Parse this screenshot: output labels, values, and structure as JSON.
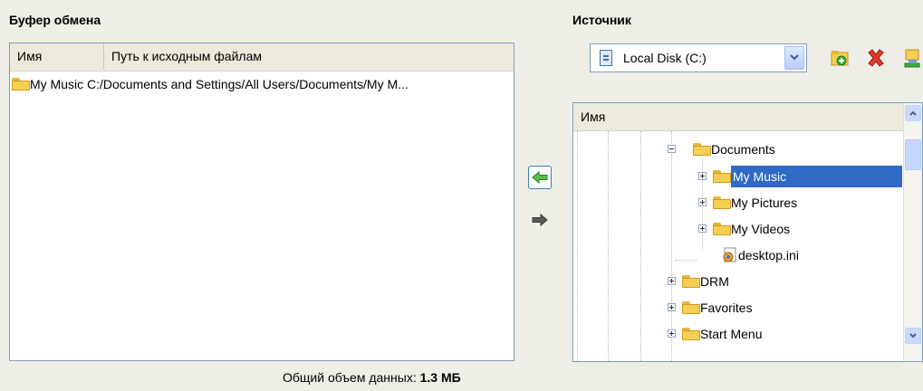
{
  "clipboard": {
    "title": "Буфер обмена",
    "columns": [
      "Имя",
      "Путь к исходным файлам"
    ],
    "rows": [
      {
        "name": "My Music",
        "path": "C:/Documents and Settings/All Users/Documents/My M..."
      }
    ],
    "total_label": "Общий объем данных:",
    "total_value": "1.3 МБ"
  },
  "source": {
    "title": "Источник",
    "drive": "Local Disk (C:)",
    "tree_header": "Имя",
    "tree": [
      {
        "label": "Documents",
        "expander": "minus",
        "selected": false
      },
      {
        "label": "My Music",
        "expander": "plus",
        "selected": true
      },
      {
        "label": "My Pictures",
        "expander": "plus",
        "selected": false
      },
      {
        "label": "My Videos",
        "expander": "plus",
        "selected": false
      },
      {
        "label": "desktop.ini",
        "expander": "none",
        "selected": false
      },
      {
        "label": "DRM",
        "expander": "plus",
        "selected": false
      },
      {
        "label": "Favorites",
        "expander": "plus",
        "selected": false
      },
      {
        "label": "Start Menu",
        "expander": "plus",
        "selected": false
      }
    ]
  },
  "icons": {
    "folder": "folder-icon",
    "add": "add-folder-icon",
    "delete": "delete-icon",
    "network": "network-drive-icon",
    "arrow_left": "arrow-left-icon",
    "arrow_right": "arrow-right-icon"
  },
  "colors": {
    "selection": "#316ac5",
    "window_bg": "#eeeee6",
    "border": "#7f9db9"
  }
}
